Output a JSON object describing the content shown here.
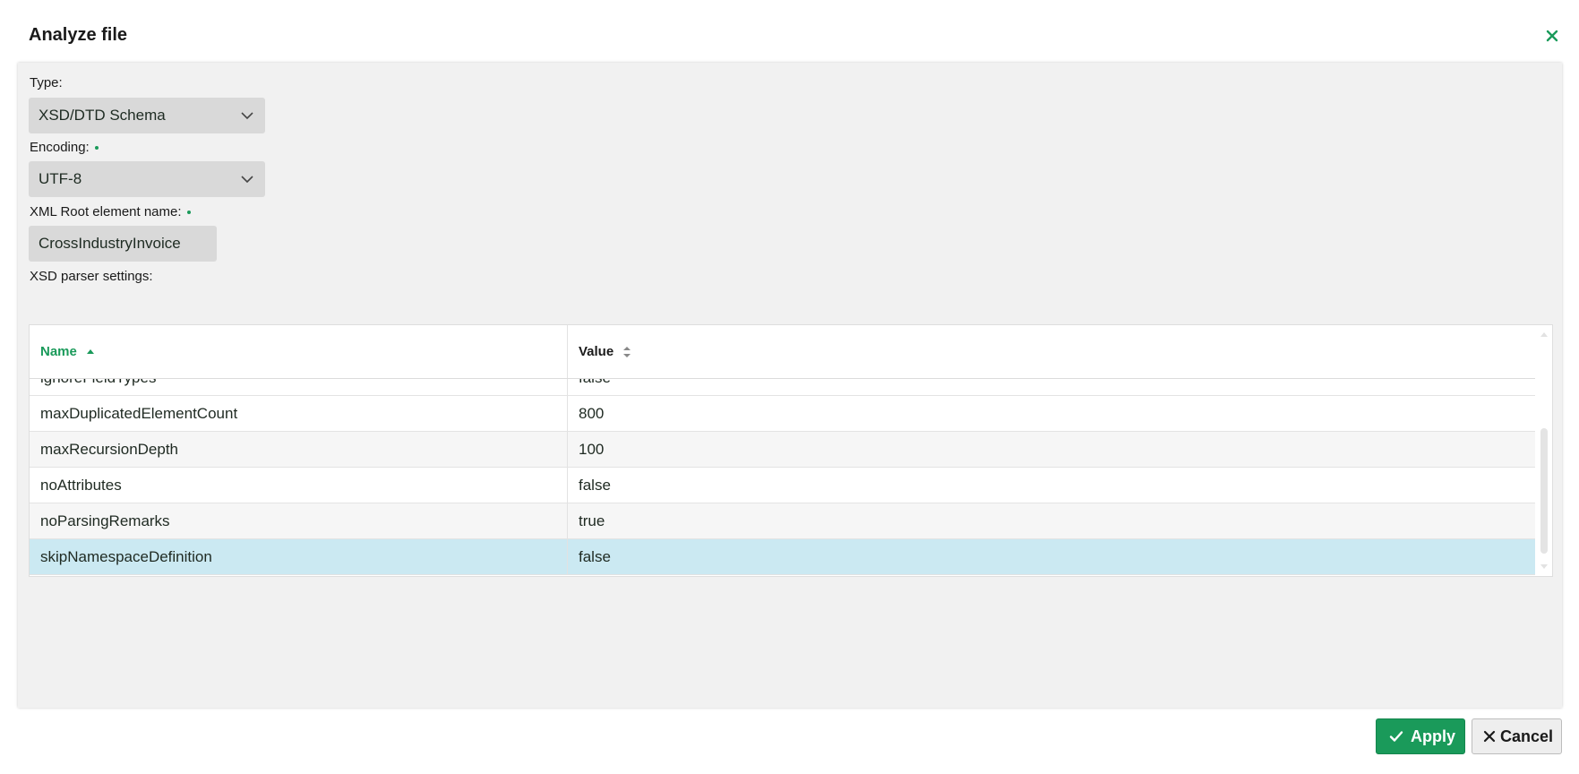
{
  "dialog": {
    "title": "Analyze file",
    "close_icon": "close-icon"
  },
  "form": {
    "type": {
      "label": "Type:",
      "value": "XSD/DTD Schema"
    },
    "encoding": {
      "label": "Encoding:",
      "value": "UTF-8",
      "required": true
    },
    "root_element": {
      "label": "XML Root element name:",
      "value": "CrossIndustryInvoice",
      "required": true
    },
    "parser_settings_label": "XSD parser settings:"
  },
  "grid": {
    "columns": [
      {
        "label": "Name",
        "sort": "ascending"
      },
      {
        "label": "Value",
        "sort": "none"
      }
    ],
    "rows": [
      {
        "name": "ignoreFieldTypes",
        "value": "false"
      },
      {
        "name": "maxDuplicatedElementCount",
        "value": "800"
      },
      {
        "name": "maxRecursionDepth",
        "value": "100"
      },
      {
        "name": "noAttributes",
        "value": "false"
      },
      {
        "name": "noParsingRemarks",
        "value": "true"
      },
      {
        "name": "skipNamespaceDefinition",
        "value": "false",
        "selected": true
      }
    ]
  },
  "buttons": {
    "apply": "Apply",
    "cancel": "Cancel"
  },
  "colors": {
    "accent": "#1a9a5a",
    "selected_row": "#cbe9f2",
    "panel_bg": "#f1f1f1",
    "field_bg": "#d9d9d9"
  }
}
